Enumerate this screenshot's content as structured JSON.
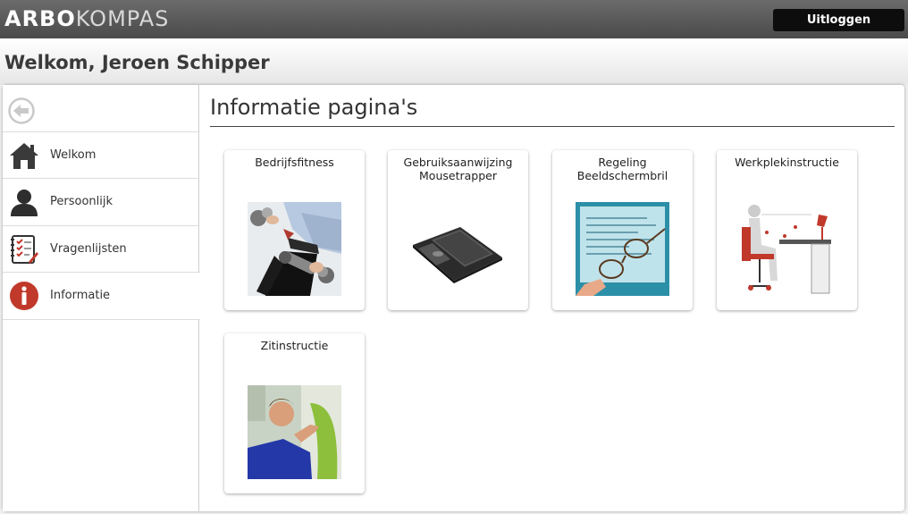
{
  "app": {
    "logo_bold": "ARBO",
    "logo_light": "KOMPAS",
    "logout_label": "Uitloggen"
  },
  "header": {
    "welcome": "Welkom, Jeroen Schipper"
  },
  "sidebar": {
    "items": [
      {
        "label": "Welkom",
        "icon": "home-icon"
      },
      {
        "label": "Persoonlijk",
        "icon": "person-icon"
      },
      {
        "label": "Vragenlijsten",
        "icon": "checklist-icon"
      },
      {
        "label": "Informatie",
        "icon": "info-icon",
        "active": true
      }
    ]
  },
  "main": {
    "title": "Informatie pagina's",
    "cards": [
      {
        "line1": "Bedrijfsfitness",
        "line2": ""
      },
      {
        "line1": "Gebruiksaanwijzing",
        "line2": "Mousetrapper"
      },
      {
        "line1": "Regeling",
        "line2": "Beeldschermbril"
      },
      {
        "line1": "Werkplekinstructie",
        "line2": ""
      },
      {
        "line1": "Zitinstructie",
        "line2": ""
      }
    ]
  },
  "colors": {
    "topbar": "#555555",
    "logout_bg": "#0d0d0d",
    "info_red": "#c0392b"
  }
}
